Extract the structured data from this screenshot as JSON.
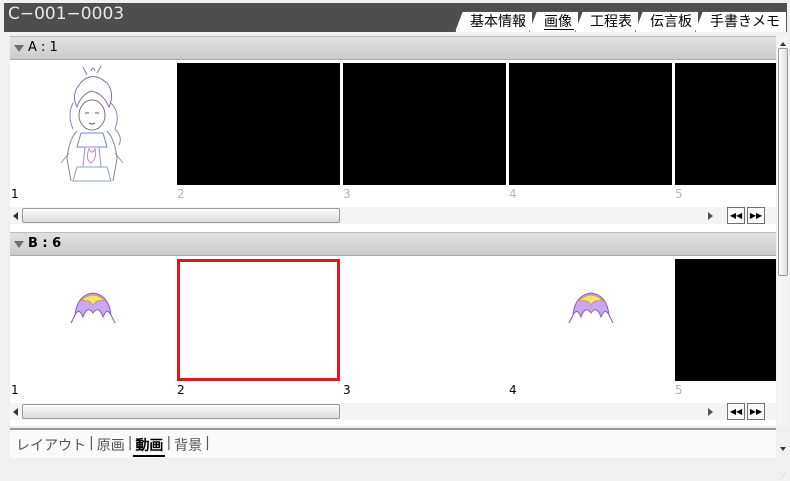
{
  "window": {
    "title": "C−001−0003",
    "tabs": [
      {
        "label": "基本情報",
        "active": false
      },
      {
        "label": "画像",
        "active": true
      },
      {
        "label": "工程表",
        "active": false
      },
      {
        "label": "伝言板",
        "active": false
      },
      {
        "label": "手書きメモ",
        "active": false
      }
    ]
  },
  "sections": [
    {
      "header": "A : 1",
      "thumbnails": [
        {
          "number": "1",
          "content": "character-drawing",
          "dim": false
        },
        {
          "number": "2",
          "content": "black",
          "dim": true
        },
        {
          "number": "3",
          "content": "black",
          "dim": true
        },
        {
          "number": "4",
          "content": "black",
          "dim": true
        },
        {
          "number": "5",
          "content": "black",
          "dim": true
        }
      ]
    },
    {
      "header": "B : 6",
      "thumbnails": [
        {
          "number": "1",
          "content": "hair-drawing",
          "dim": false
        },
        {
          "number": "2",
          "content": "blank-selected",
          "dim": false
        },
        {
          "number": "3",
          "content": "blank",
          "dim": false
        },
        {
          "number": "4",
          "content": "hair-drawing",
          "dim": false
        },
        {
          "number": "5",
          "content": "black",
          "dim": true
        }
      ]
    }
  ],
  "scroll_nav": {
    "prev_icon": "double-left-arrow-icon",
    "next_icon": "double-right-arrow-icon",
    "prev_glyph": "◀◀",
    "next_glyph": "▶▶"
  },
  "subtabs": [
    {
      "label": "レイアウト",
      "active": false
    },
    {
      "label": "原画",
      "active": false
    },
    {
      "label": "動画",
      "active": true
    },
    {
      "label": "背景",
      "active": false
    }
  ],
  "colors": {
    "selection": "#e0181c",
    "titlebar": "#4e4e4e"
  }
}
